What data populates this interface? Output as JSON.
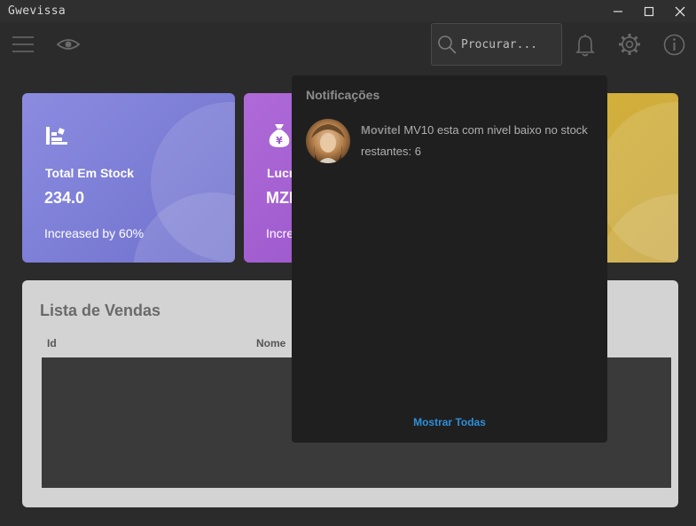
{
  "window": {
    "title": "Gwevissa"
  },
  "toolbar": {
    "search_placeholder": "Procurar...",
    "icons": [
      "menu-icon",
      "eye-icon",
      "bell-icon",
      "gear-icon",
      "info-icon"
    ]
  },
  "cards": [
    {
      "title": "Total Em Stock",
      "value": "234.0",
      "subtitle": "Increased by 60%",
      "color": "#7c7ed8",
      "icon": "stock-icon"
    },
    {
      "title": "Lucr",
      "value": "MZI",
      "subtitle": "Incre",
      "color": "#a05fd0",
      "icon": "money-bag-icon"
    },
    {
      "color": "#d9b23a"
    }
  ],
  "sales": {
    "title": "Lista de Vendas",
    "columns": [
      "Id",
      "Nome"
    ]
  },
  "notifications": {
    "title": "Notificações",
    "items": [
      {
        "source": "Movitel",
        "message": "MV10 esta com nivel baixo no stock restantes: 6"
      }
    ],
    "show_all": "Mostrar Todas"
  },
  "colors": {
    "background": "#2b2b2b",
    "popup": "#1f1f1f",
    "link": "#2f8fd8"
  }
}
